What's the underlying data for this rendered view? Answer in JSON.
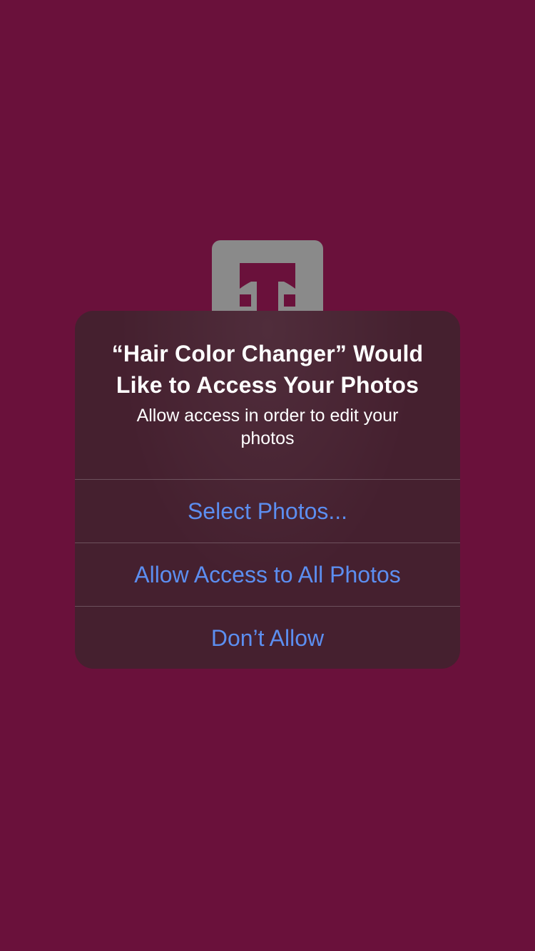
{
  "app": {
    "logo_icon": "t-logo-icon"
  },
  "alert": {
    "title": "“Hair Color Changer” Would Like to Access Your Photos",
    "message": "Allow access in order to edit your photos",
    "buttons": [
      {
        "label": "Select Photos..."
      },
      {
        "label": "Allow Access to All Photos"
      },
      {
        "label": "Don’t Allow"
      }
    ]
  },
  "colors": {
    "background": "#6a113b",
    "alert_background": "#45202f",
    "button_text": "#5c8ef0",
    "logo_tile": "#8a8a8a"
  }
}
